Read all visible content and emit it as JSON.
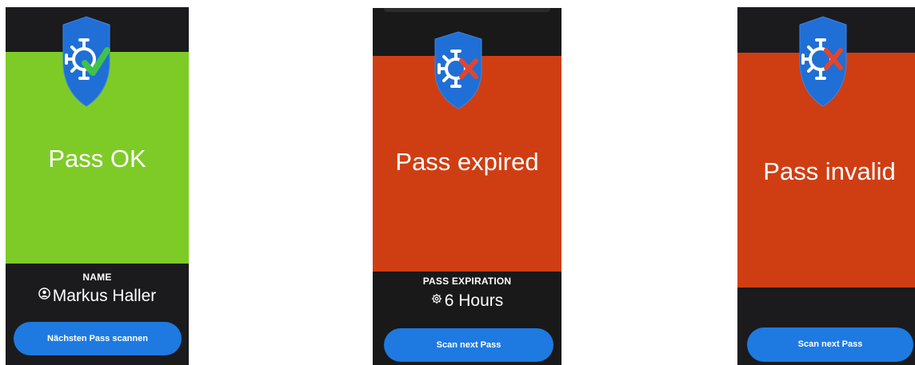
{
  "colors": {
    "ok_green": "#7ecb27",
    "error_red": "#cf3e13",
    "button_blue": "#1e7ae0",
    "phone_bg": "#1b1b1d",
    "shield_blue": "#1f6fd6",
    "check_green": "#3fc24a",
    "x_red": "#e2452e"
  },
  "screens": [
    {
      "status_text": "Pass OK",
      "status_color": "#7ecb27",
      "icon": "shield-check-icon",
      "info_label": "NAME",
      "info_value": "Markus Haller",
      "info_icon": "person-circle-icon",
      "button_label": "Nächsten Pass scannen"
    },
    {
      "status_text": "Pass expired",
      "status_color": "#cf3e13",
      "icon": "shield-x-icon",
      "info_label": "PASS EXPIRATION",
      "info_value": "6 Hours",
      "info_icon": "gear-icon",
      "button_label": "Scan next Pass"
    },
    {
      "status_text": "Pass invalid",
      "status_color": "#cf3e13",
      "icon": "shield-x-icon",
      "button_label": "Scan next Pass"
    }
  ]
}
